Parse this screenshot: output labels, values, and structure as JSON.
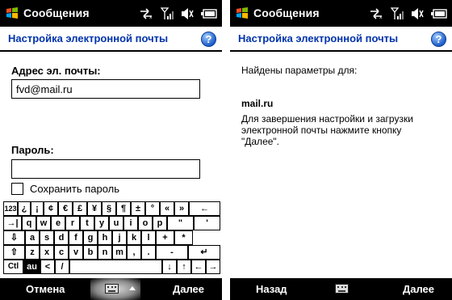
{
  "left": {
    "app_title": "Сообщения",
    "header_title": "Настройка электронной почты",
    "help": "?",
    "email": {
      "label": "Адрес эл. почты:",
      "value": "fvd@mail.ru"
    },
    "password": {
      "label": "Пароль:",
      "value": ""
    },
    "save_password_label": "Сохранить пароль",
    "softkeys": {
      "left": "Отмена",
      "right": "Далее"
    }
  },
  "right": {
    "app_title": "Сообщения",
    "header_title": "Настройка электронной почты",
    "help": "?",
    "found_text": "Найдены параметры для:",
    "domain": "mail.ru",
    "instructions_line1": "Для завершения настройки и загрузки",
    "instructions_line2": "электронной почты нажмите кнопку",
    "instructions_line3": "\"Далее\".",
    "softkeys": {
      "left": "Назад",
      "right": "Далее"
    }
  },
  "icons": [
    "windows-start-icon",
    "connectivity-arrows-icon",
    "signal-strength-icon",
    "speaker-muted-icon",
    "battery-icon",
    "help-icon",
    "keyboard-icon"
  ],
  "keyboard": {
    "rows": [
      [
        "123",
        "¿",
        "¡",
        "¢",
        "€",
        "£",
        "¥",
        "§",
        "¶",
        "±",
        "°",
        "«",
        "»",
        "←"
      ],
      [
        "→|",
        "q",
        "w",
        "e",
        "r",
        "t",
        "y",
        "u",
        "i",
        "o",
        "p",
        "\"",
        "'"
      ],
      [
        "⇩",
        "a",
        "s",
        "d",
        "f",
        "g",
        "h",
        "j",
        "k",
        "l",
        "+",
        "*"
      ],
      [
        "⇧",
        "z",
        "x",
        "c",
        "v",
        "b",
        "n",
        "m",
        ",",
        ".",
        "-",
        "↵"
      ],
      [
        "Ctl",
        "au",
        "<",
        "/",
        "",
        "↓",
        "↑",
        "←",
        "→"
      ]
    ]
  }
}
